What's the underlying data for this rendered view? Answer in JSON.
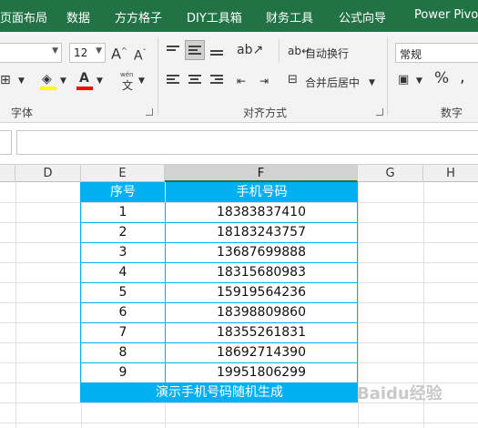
{
  "tabs": [
    "页面布局",
    "数据",
    "方方格子",
    "DIY工具箱",
    "财务工具",
    "公式向导",
    "Power Pivot"
  ],
  "ribbon": {
    "font_size": "12",
    "grow_font": "A",
    "shrink_font": "A",
    "wen_label": "wén",
    "wen_char": "文",
    "wrap_text": "自动换行",
    "merge_center": "合并后居中",
    "number_format": "常规",
    "percent": "%",
    "comma": ",",
    "group_font": "字体",
    "group_alignment": "对齐方式",
    "group_number": "数字",
    "colors": {
      "fill": "#ffff00",
      "font": "#ff0000",
      "accent": "#217346"
    }
  },
  "columns": [
    "D",
    "E",
    "F",
    "G",
    "H"
  ],
  "table": {
    "headers": [
      "序号",
      "手机号码"
    ],
    "rows": [
      [
        "1",
        "18383837410"
      ],
      [
        "2",
        "18183243757"
      ],
      [
        "3",
        "13687699888"
      ],
      [
        "4",
        "18315680983"
      ],
      [
        "5",
        "15919564236"
      ],
      [
        "6",
        "18398809860"
      ],
      [
        "7",
        "18355261831"
      ],
      [
        "8",
        "18692714390"
      ],
      [
        "9",
        "19951806299"
      ]
    ],
    "footer": "演示手机号码随机生成",
    "header_color": "#00b0f0"
  },
  "watermark": "Baidu经验"
}
